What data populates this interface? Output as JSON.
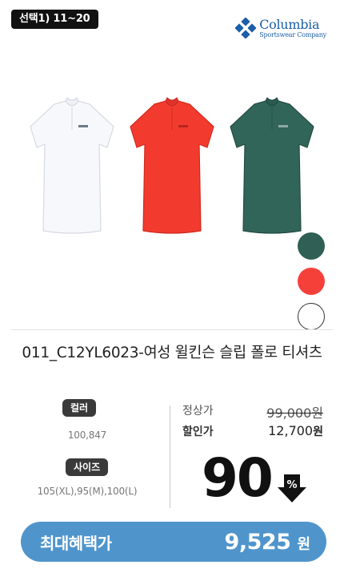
{
  "badge": {
    "label": "선택1) 11~20"
  },
  "brand": {
    "name": "Columbia",
    "sub": "Sportswear Company",
    "color": "#1b5fa8"
  },
  "product": {
    "title": "011_C12YL6023-여성 윌킨슨 슬립 폴로 티셔츠",
    "shirts": [
      {
        "name": "white",
        "color": "#f7f8fb"
      },
      {
        "name": "red",
        "color": "#f23b2e"
      },
      {
        "name": "green",
        "color": "#31655a"
      }
    ],
    "swatches": [
      {
        "name": "green",
        "color": "#2f5f55"
      },
      {
        "name": "red",
        "color": "#f5403a"
      },
      {
        "name": "white",
        "color": "#ffffff"
      }
    ]
  },
  "options": {
    "color_label": "컬러",
    "color_values": "100,847",
    "size_label": "사이즈",
    "size_values": "105(XL),95(M),100(L)"
  },
  "price": {
    "regular_label": "정상가",
    "regular_value": "99,000",
    "discount_label": "할인가",
    "discount_value": "12,700",
    "currency": "원",
    "discount_rate": "90",
    "discount_unit": "%"
  },
  "benefit": {
    "label": "최대혜택가",
    "amount": "9,525",
    "unit": "원",
    "color": "#4f95cc"
  }
}
